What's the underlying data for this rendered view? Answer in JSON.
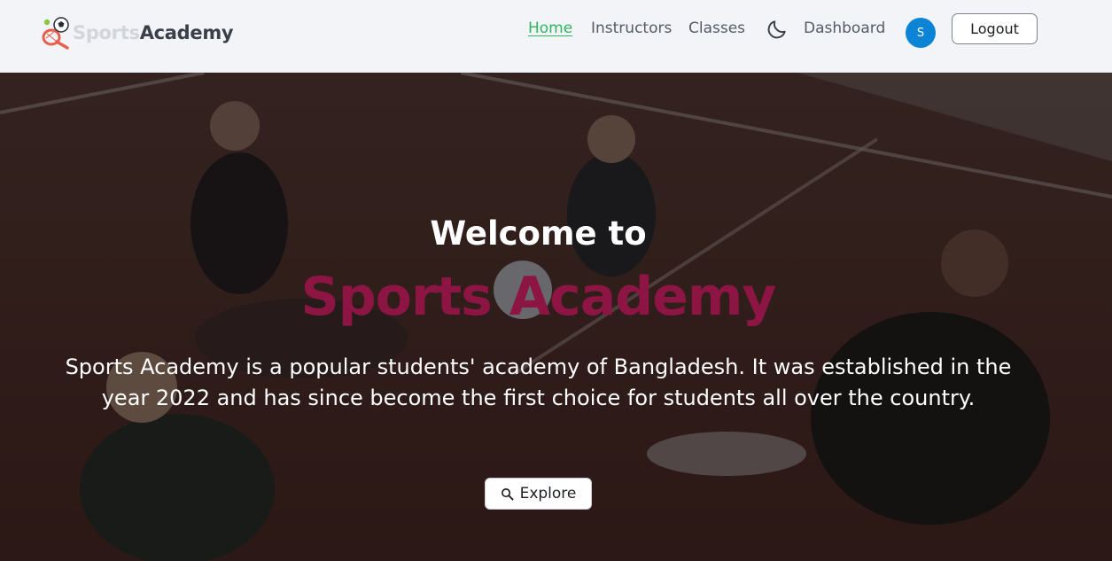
{
  "brand": {
    "name_part1": "Sports",
    "name_part2": "Academy",
    "logo_icon": "sports-ball-racket-icon"
  },
  "nav": {
    "links": [
      {
        "label": "Home",
        "active": true
      },
      {
        "label": "Instructors",
        "active": false
      },
      {
        "label": "Classes",
        "active": false
      },
      {
        "label": "Dashboard",
        "active": false
      }
    ],
    "theme_toggle_icon": "moon-icon",
    "avatar_initial": "S",
    "logout_label": "Logout"
  },
  "hero": {
    "welcome": "Welcome to",
    "title": "Sports Academy",
    "description": "Sports Academy is a popular students' academy of Bangladesh. It was established in the year 2022 and has since become the first choice for students all over the country.",
    "explore_label": "Explore",
    "explore_icon": "search-icon"
  },
  "colors": {
    "nav_bg": "#f2f4f8",
    "active_link": "#2eb75f",
    "brand_title": "#8c1543",
    "avatar_bg": "#0b84d6"
  }
}
